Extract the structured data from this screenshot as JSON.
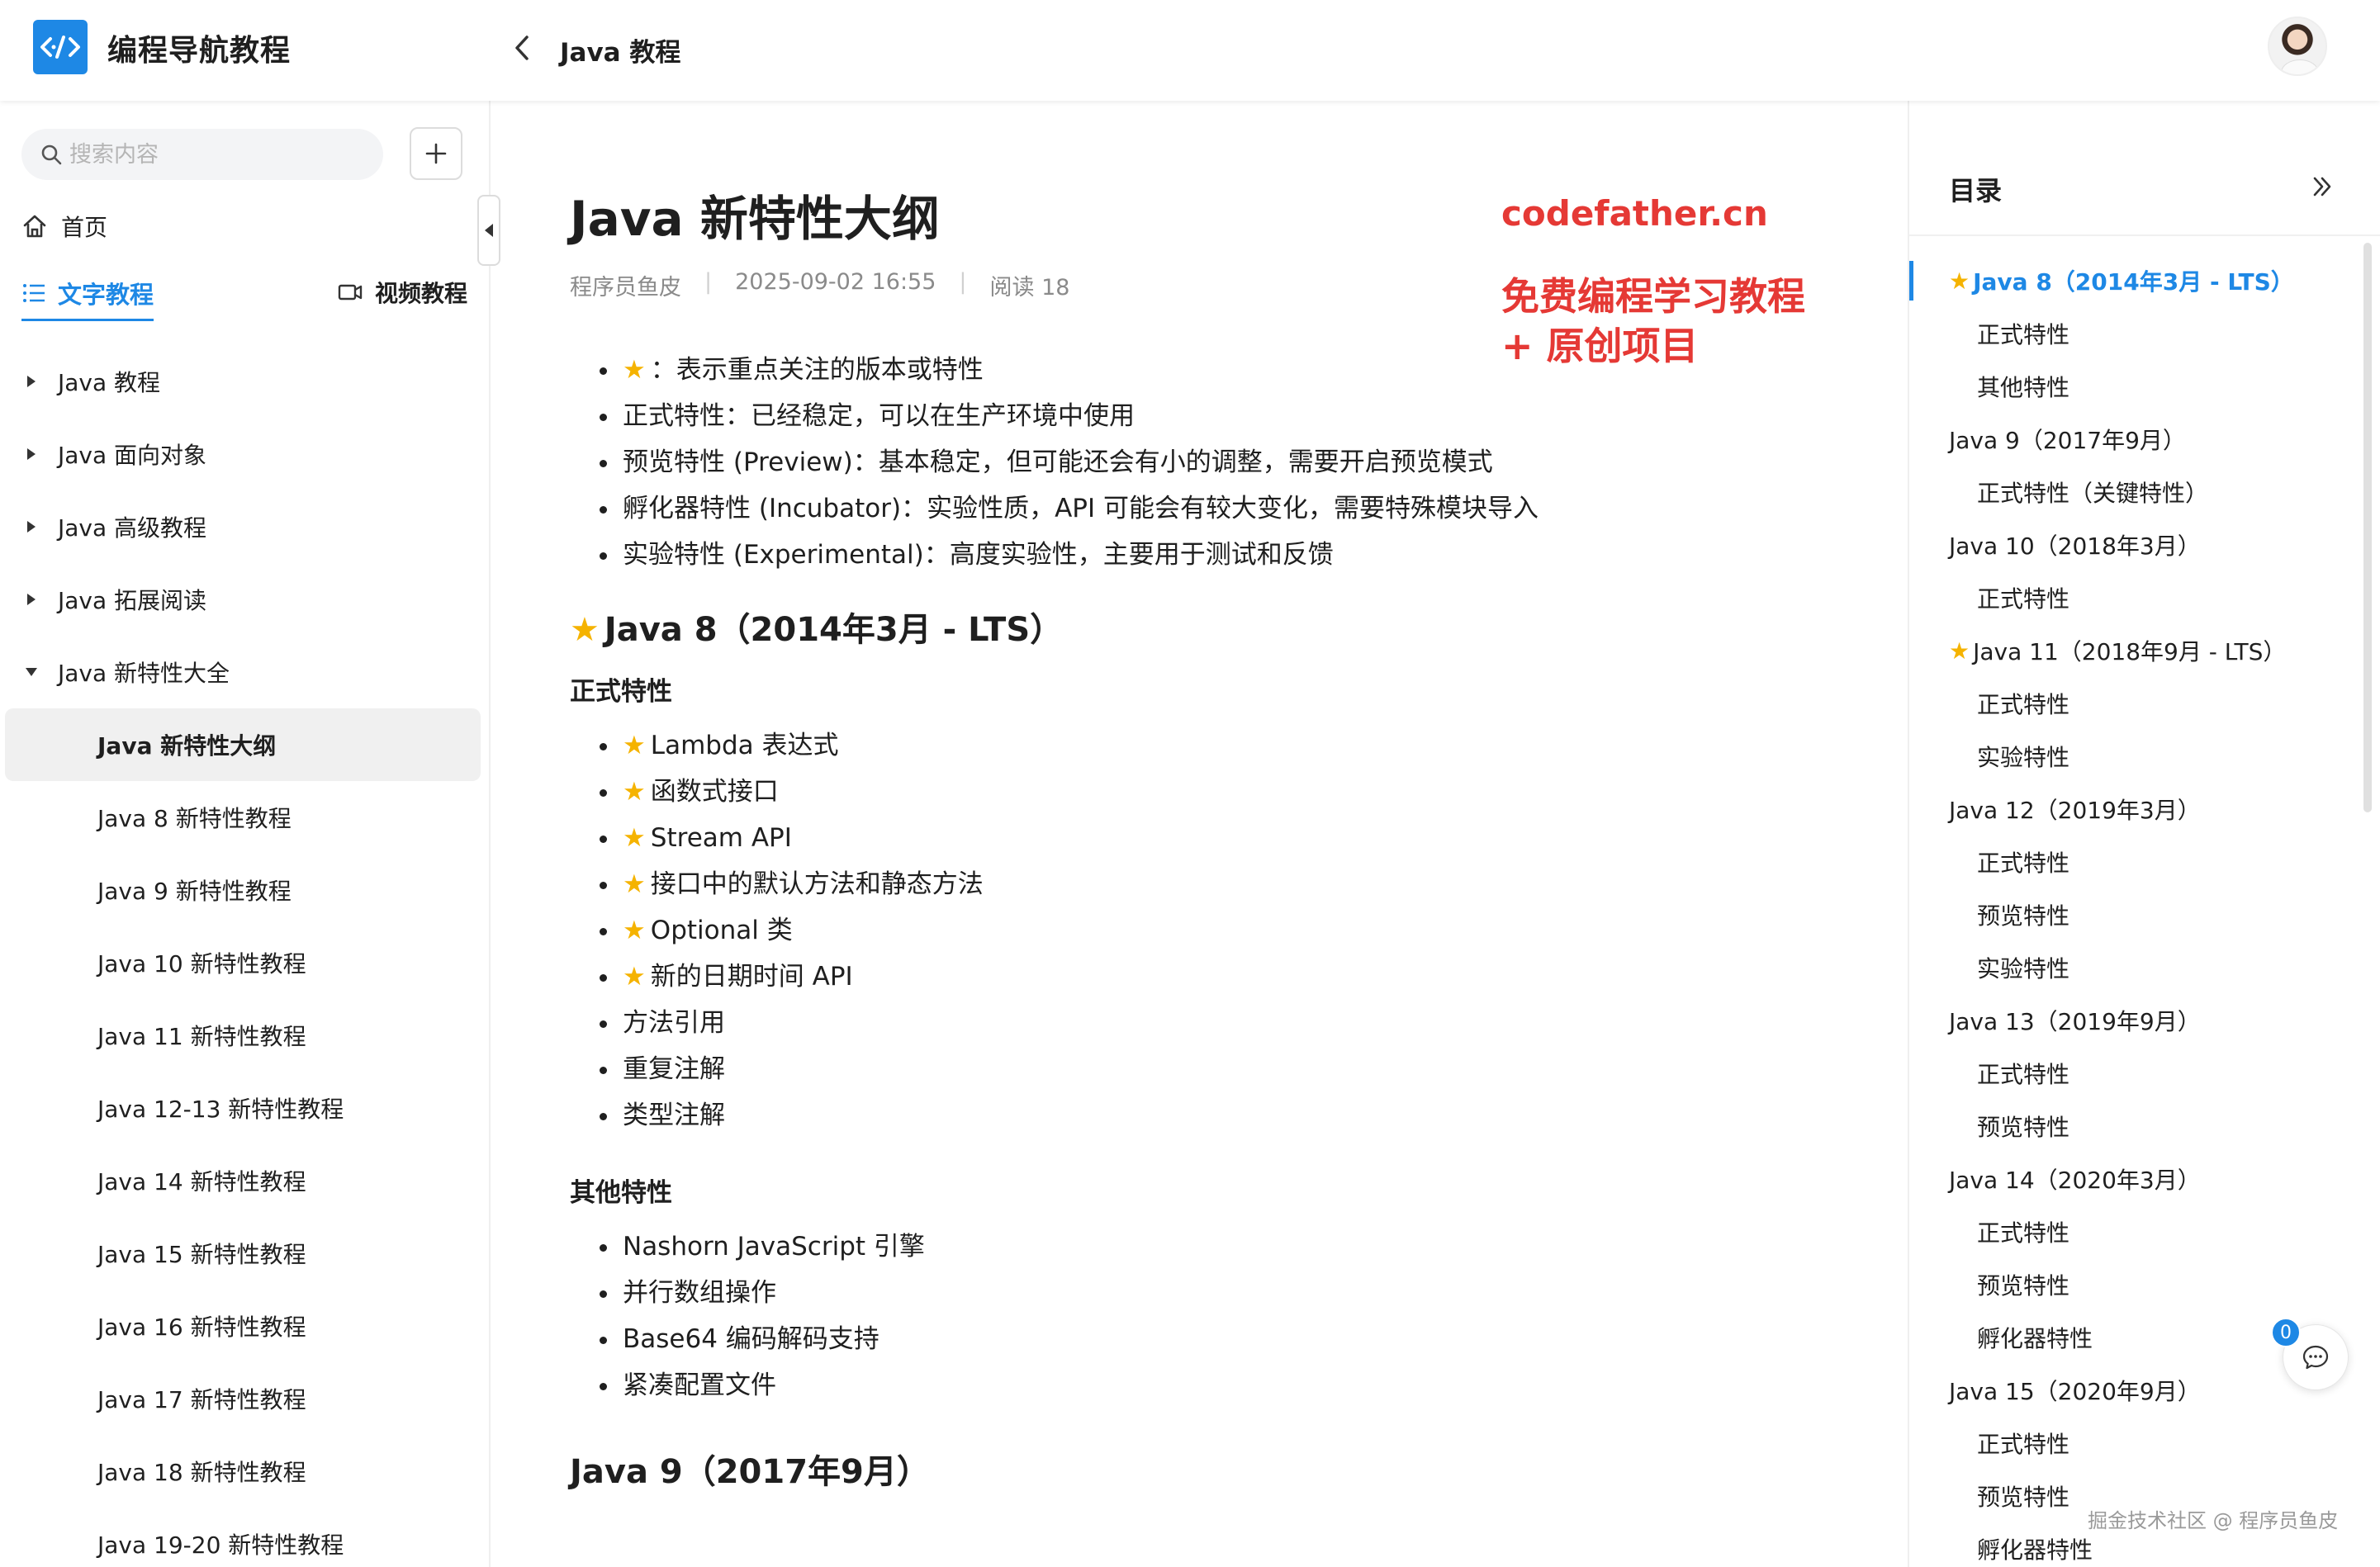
{
  "header": {
    "site_title": "编程导航教程",
    "breadcrumb": "Java 教程"
  },
  "sidebar": {
    "search_placeholder": "搜索内容",
    "home_label": "首页",
    "tab_text": "文字教程",
    "tab_video": "视频教程",
    "items": [
      {
        "label": "Java 教程",
        "level": 1,
        "caret": "right"
      },
      {
        "label": "Java 面向对象",
        "level": 1,
        "caret": "right"
      },
      {
        "label": "Java 高级教程",
        "level": 1,
        "caret": "right"
      },
      {
        "label": "Java 拓展阅读",
        "level": 1,
        "caret": "right"
      },
      {
        "label": "Java 新特性大全",
        "level": 1,
        "caret": "down"
      },
      {
        "label": "Java 新特性大纲",
        "level": 2,
        "active": true
      },
      {
        "label": "Java 8 新特性教程",
        "level": 2
      },
      {
        "label": "Java 9 新特性教程",
        "level": 2
      },
      {
        "label": "Java 10 新特性教程",
        "level": 2
      },
      {
        "label": "Java 11 新特性教程",
        "level": 2
      },
      {
        "label": "Java 12-13 新特性教程",
        "level": 2
      },
      {
        "label": "Java 14 新特性教程",
        "level": 2
      },
      {
        "label": "Java 15 新特性教程",
        "level": 2
      },
      {
        "label": "Java 16 新特性教程",
        "level": 2
      },
      {
        "label": "Java 17 新特性教程",
        "level": 2
      },
      {
        "label": "Java 18 新特性教程",
        "level": 2
      },
      {
        "label": "Java 19-20 新特性教程",
        "level": 2
      }
    ]
  },
  "article": {
    "title": "Java 新特性大纲",
    "author": "程序员鱼皮",
    "date": "2025-09-02 16:55",
    "reads": "阅读 18",
    "promo_line1": "codefather.cn",
    "promo_line2": "免费编程学习教程",
    "promo_line3": "+ 原创项目",
    "legend": [
      {
        "star": true,
        "text": "：表示重点关注的版本或特性"
      },
      {
        "star": false,
        "text": "正式特性：已经稳定，可以在生产环境中使用"
      },
      {
        "star": false,
        "text": "预览特性 (Preview)：基本稳定，但可能还会有小的调整，需要开启预览模式"
      },
      {
        "star": false,
        "text": "孵化器特性 (Incubator)：实验性质，API 可能会有较大变化，需要特殊模块导入"
      },
      {
        "star": false,
        "text": "实验特性 (Experimental)：高度实验性，主要用于测试和反馈"
      }
    ],
    "java8_heading": "Java 8（2014年3月 - LTS）",
    "official_heading": "正式特性",
    "official_items": [
      {
        "star": true,
        "text": "Lambda 表达式"
      },
      {
        "star": true,
        "text": "函数式接口"
      },
      {
        "star": true,
        "text": "Stream API"
      },
      {
        "star": true,
        "text": "接口中的默认方法和静态方法"
      },
      {
        "star": true,
        "text": "Optional 类"
      },
      {
        "star": true,
        "text": "新的日期时间 API"
      },
      {
        "star": false,
        "text": "方法引用"
      },
      {
        "star": false,
        "text": "重复注解"
      },
      {
        "star": false,
        "text": "类型注解"
      }
    ],
    "other_heading": "其他特性",
    "other_items": [
      {
        "star": false,
        "text": "Nashorn JavaScript 引擎"
      },
      {
        "star": false,
        "text": "并行数组操作"
      },
      {
        "star": false,
        "text": "Base64 编码解码支持"
      },
      {
        "star": false,
        "text": "紧凑配置文件"
      }
    ],
    "java9_heading": "Java 9（2017年9月）"
  },
  "toc": {
    "title": "目录",
    "items": [
      {
        "text": "Java 8（2014年3月 - LTS）",
        "level": 1,
        "star": true,
        "active": true
      },
      {
        "text": "正式特性",
        "level": 2
      },
      {
        "text": "其他特性",
        "level": 2
      },
      {
        "text": "Java 9（2017年9月）",
        "level": 1
      },
      {
        "text": "正式特性（关键特性）",
        "level": 2
      },
      {
        "text": "Java 10（2018年3月）",
        "level": 1
      },
      {
        "text": "正式特性",
        "level": 2
      },
      {
        "text": "Java 11（2018年9月 - LTS）",
        "level": 1,
        "star": true
      },
      {
        "text": "正式特性",
        "level": 2
      },
      {
        "text": "实验特性",
        "level": 2
      },
      {
        "text": "Java 12（2019年3月）",
        "level": 1
      },
      {
        "text": "正式特性",
        "level": 2
      },
      {
        "text": "预览特性",
        "level": 2
      },
      {
        "text": "实验特性",
        "level": 2
      },
      {
        "text": "Java 13（2019年9月）",
        "level": 1
      },
      {
        "text": "正式特性",
        "level": 2
      },
      {
        "text": "预览特性",
        "level": 2
      },
      {
        "text": "Java 14（2020年3月）",
        "level": 1
      },
      {
        "text": "正式特性",
        "level": 2
      },
      {
        "text": "预览特性",
        "level": 2
      },
      {
        "text": "孵化器特性",
        "level": 2
      },
      {
        "text": "Java 15（2020年9月）",
        "level": 1
      },
      {
        "text": "正式特性",
        "level": 2
      },
      {
        "text": "预览特性",
        "level": 2
      },
      {
        "text": "孵化器特性",
        "level": 2
      }
    ]
  },
  "chat": {
    "badge_count": "0"
  },
  "credit": "掘金技术社区 @ 程序员鱼皮",
  "colors": {
    "accent": "#1e88e5",
    "promo": "#e53935",
    "star": "#f5b300"
  }
}
